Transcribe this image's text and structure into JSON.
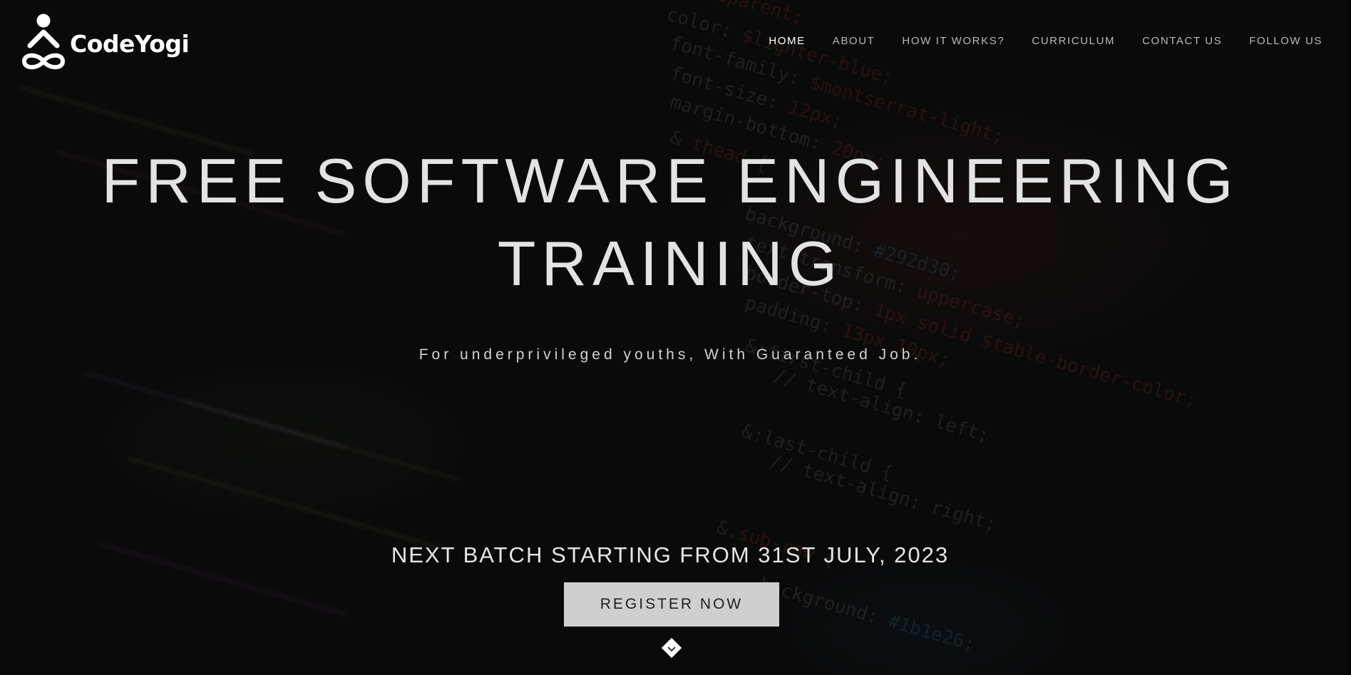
{
  "brand": {
    "name": "CodeYogi",
    "logo_icon": "yogi-infinity-logo"
  },
  "nav": {
    "items": [
      {
        "label": "HOME",
        "active": true
      },
      {
        "label": "ABOUT",
        "active": false
      },
      {
        "label": "HOW IT WORKS?",
        "active": false
      },
      {
        "label": "CURRICULUM",
        "active": false
      },
      {
        "label": "CONTACT US",
        "active": false
      },
      {
        "label": "FOLLOW US",
        "active": false
      }
    ]
  },
  "hero": {
    "headline_line1": "FREE SOFTWARE ENGINEERING",
    "headline_line2": "TRAINING",
    "subtitle": "For underprivileged youths, With Guaranteed Job.",
    "batch_notice": "NEXT BATCH STARTING FROM 31ST JULY, 2023",
    "cta_label": "REGISTER NOW",
    "scroll_icon": "chevron-down-icon"
  },
  "colors": {
    "background": "#0c0c0d",
    "text": "#e3e3e3",
    "button_bg": "#cfcfcf",
    "button_text": "#1f1f1f",
    "nav_active": "#ffffff",
    "nav_inactive": "#b9b9b9"
  }
}
